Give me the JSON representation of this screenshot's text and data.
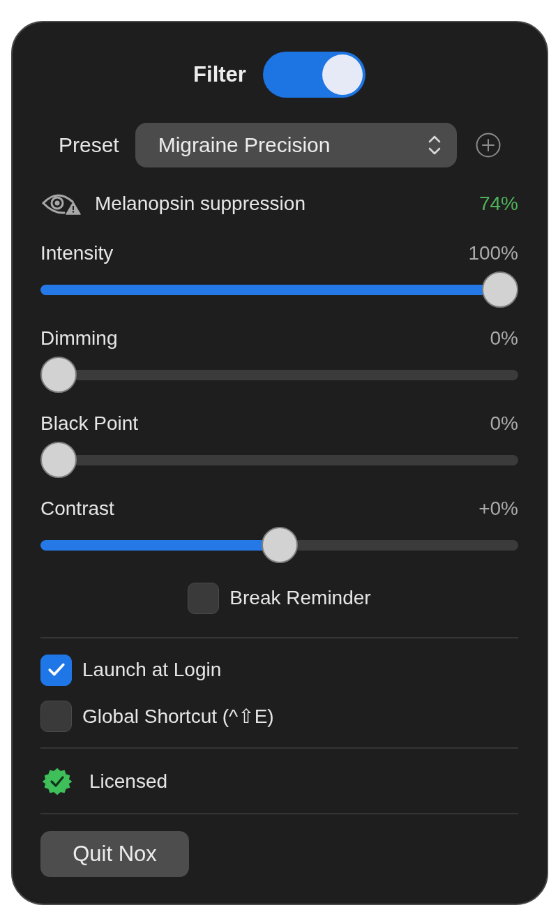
{
  "filter": {
    "label": "Filter",
    "on": true
  },
  "preset": {
    "label": "Preset",
    "value": "Migraine Precision"
  },
  "melanopsin": {
    "label": "Melanopsin suppression",
    "value": "74%"
  },
  "sliders": [
    {
      "label": "Intensity",
      "value": "100%",
      "level": 1
    },
    {
      "label": "Dimming",
      "value": "0%",
      "level": 0
    },
    {
      "label": "Black Point",
      "value": "0%",
      "level": 0
    },
    {
      "label": "Contrast",
      "value": "+0%",
      "level": 0.5
    }
  ],
  "break_reminder": {
    "label": "Break Reminder",
    "checked": false
  },
  "options": [
    {
      "label": "Launch at Login",
      "checked": true
    },
    {
      "label": "Global Shortcut (^⇧E)",
      "checked": false
    }
  ],
  "license": {
    "label": "Licensed"
  },
  "quit_button": {
    "label": "Quit Nox"
  }
}
